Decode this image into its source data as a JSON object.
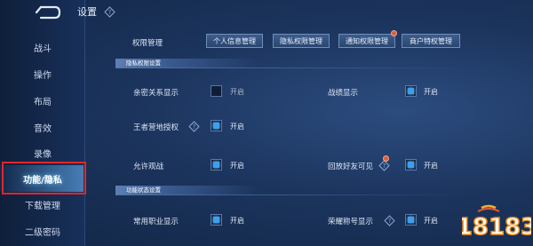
{
  "header": {
    "title": "设置"
  },
  "sidebar": {
    "items": [
      {
        "label": "战斗"
      },
      {
        "label": "操作"
      },
      {
        "label": "布局"
      },
      {
        "label": "音效"
      },
      {
        "label": "录像"
      },
      {
        "label": "功能/隐私",
        "active": true
      },
      {
        "label": "下载管理"
      },
      {
        "label": "二级密码"
      }
    ]
  },
  "permissions": {
    "label": "权限管理",
    "tabs": [
      {
        "label": "个人信息管理"
      },
      {
        "label": "隐私权限管理"
      },
      {
        "label": "通知权限管理"
      },
      {
        "label": "商户特权管理"
      }
    ]
  },
  "privacy_section": {
    "title": "隐私权限设置",
    "rows": [
      {
        "label": "亲密关系显示",
        "toggle": "开启",
        "checked": false
      },
      {
        "label": "战绩显示",
        "toggle": "开启",
        "checked": true
      },
      {
        "label": "王者营地授权",
        "toggle": "开启",
        "checked": true
      },
      {
        "label": "允许观战",
        "toggle": "开启",
        "checked": true
      },
      {
        "label": "回放好友可见",
        "toggle": "开启",
        "checked": true
      }
    ]
  },
  "function_section": {
    "title": "功能状态设置",
    "rows": [
      {
        "label": "常用职业显示",
        "toggle": "开启",
        "checked": true
      },
      {
        "label": "荣耀称号显示",
        "toggle": "开启",
        "checked": true
      }
    ]
  },
  "watermark": {
    "text": "18183"
  },
  "colors": {
    "accent": "#3b9ff0",
    "highlight_box": "#e0262b",
    "background": "#1c355e"
  }
}
